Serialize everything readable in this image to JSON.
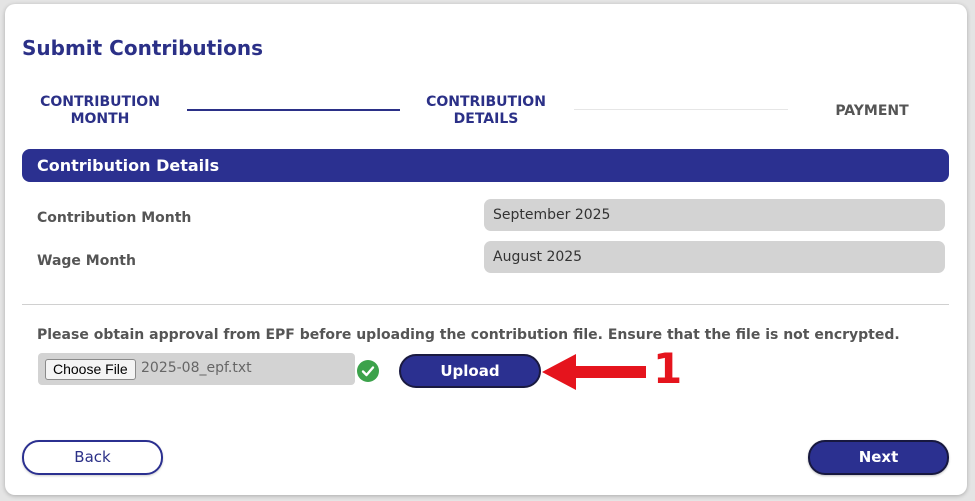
{
  "page": {
    "title": "Submit Contributions"
  },
  "stepper": {
    "steps": [
      {
        "line1": "CONTRIBUTION",
        "line2": "MONTH",
        "state": "complete"
      },
      {
        "line1": "CONTRIBUTION",
        "line2": "DETAILS",
        "state": "current"
      },
      {
        "line1": "PAYMENT",
        "line2": "",
        "state": "pending"
      }
    ]
  },
  "section": {
    "heading": "Contribution Details"
  },
  "fields": {
    "contribution_month": {
      "label": "Contribution Month",
      "value": "September 2025"
    },
    "wage_month": {
      "label": "Wage Month",
      "value": "August 2025"
    }
  },
  "upload": {
    "notice": "Please obtain approval from EPF before uploading the contribution file. Ensure that the file is not encrypted.",
    "choose_label": "Choose File",
    "file_name": "2025-08_epf.txt",
    "status_icon": "check-circle-icon",
    "button_label": "Upload"
  },
  "annotation": {
    "arrow_icon": "left-arrow-icon",
    "number": "1",
    "color": "#e5141d"
  },
  "footer": {
    "back_label": "Back",
    "next_label": "Next"
  },
  "colors": {
    "brand": "#2b3090",
    "success": "#3ca24b"
  }
}
